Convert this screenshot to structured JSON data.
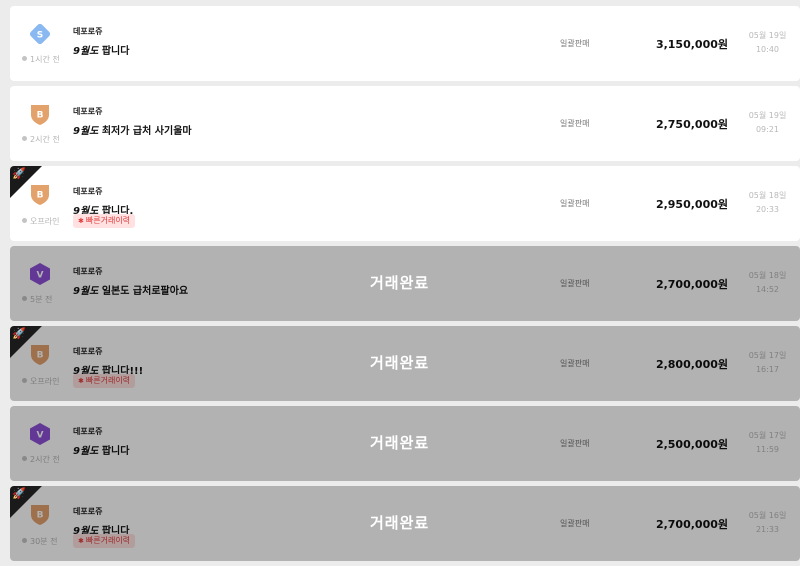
{
  "trades": [
    {
      "grade": "S",
      "badge_color": "#8ab8f0",
      "badge_shape": "diamond",
      "status": "1시간 전",
      "seller": "데포로쥬",
      "server": "9월도",
      "title": "팝니다",
      "fast": false,
      "fast_label": "",
      "completed": false,
      "completed_label": "",
      "type": "일괄판매",
      "price": "3,150,000원",
      "date_line1": "05월 19일",
      "date_line2": "10:40",
      "ribbon": false
    },
    {
      "grade": "B",
      "badge_color": "#e3a16c",
      "badge_shape": "shield",
      "status": "2시간 전",
      "seller": "데포로쥬",
      "server": "9월도",
      "title": "최저가 급처 사기울마",
      "fast": false,
      "fast_label": "",
      "completed": false,
      "completed_label": "",
      "type": "일괄판매",
      "price": "2,750,000원",
      "date_line1": "05월 19일",
      "date_line2": "09:21",
      "ribbon": false
    },
    {
      "grade": "B",
      "badge_color": "#e3a16c",
      "badge_shape": "shield",
      "status": "오프라인",
      "seller": "데포로쥬",
      "server": "9월도",
      "title": "팝니다.",
      "fast": true,
      "fast_label": "빠른거래이력",
      "completed": false,
      "completed_label": "",
      "type": "일괄판매",
      "price": "2,950,000원",
      "date_line1": "05월 18일",
      "date_line2": "20:33",
      "ribbon": true
    },
    {
      "grade": "V",
      "badge_color": "#8e4fd6",
      "badge_shape": "hexagon",
      "status": "5분 전",
      "seller": "데포로쥬",
      "server": "9월도",
      "title": "일본도 급처로팔아요",
      "fast": false,
      "fast_label": "",
      "completed": true,
      "completed_label": "거래완료",
      "type": "일괄판매",
      "price": "2,700,000원",
      "date_line1": "05월 18일",
      "date_line2": "14:52",
      "ribbon": false
    },
    {
      "grade": "B",
      "badge_color": "#e3a16c",
      "badge_shape": "shield",
      "status": "오프라인",
      "seller": "데포로쥬",
      "server": "9월도",
      "title": "팝니다!!!",
      "fast": true,
      "fast_label": "빠른거래이력",
      "completed": true,
      "completed_label": "거래완료",
      "type": "일괄판매",
      "price": "2,800,000원",
      "date_line1": "05월 17일",
      "date_line2": "16:17",
      "ribbon": true
    },
    {
      "grade": "V",
      "badge_color": "#8e4fd6",
      "badge_shape": "hexagon",
      "status": "2시간 전",
      "seller": "데포로쥬",
      "server": "9월도",
      "title": "팝니다",
      "fast": false,
      "fast_label": "",
      "completed": true,
      "completed_label": "거래완료",
      "type": "일괄판매",
      "price": "2,500,000원",
      "date_line1": "05월 17일",
      "date_line2": "11:59",
      "ribbon": false
    },
    {
      "grade": "B",
      "badge_color": "#e3a16c",
      "badge_shape": "shield",
      "status": "30분 전",
      "seller": "데포로쥬",
      "server": "9월도",
      "title": "팝니다",
      "fast": true,
      "fast_label": "빠른거래이력",
      "completed": true,
      "completed_label": "거래완료",
      "type": "일괄판매",
      "price": "2,700,000원",
      "date_line1": "05월 16일",
      "date_line2": "21:33",
      "ribbon": true
    }
  ],
  "icons": {
    "ribbon": "rocket-icon",
    "fast": "network-icon",
    "badge": "grade-badge-icon"
  }
}
